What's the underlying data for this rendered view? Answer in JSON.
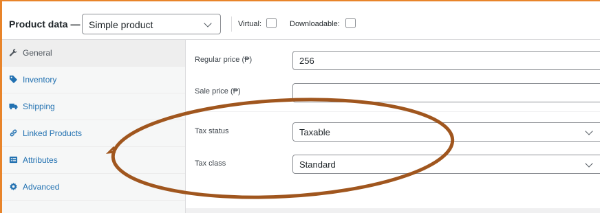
{
  "header": {
    "title": "Product data —",
    "product_type": "Simple product",
    "virtual_label": "Virtual:",
    "downloadable_label": "Downloadable:"
  },
  "sidebar": {
    "items": [
      {
        "label": "General",
        "icon": "wrench-icon",
        "active": true
      },
      {
        "label": "Inventory",
        "icon": "tag-icon",
        "active": false
      },
      {
        "label": "Shipping",
        "icon": "truck-icon",
        "active": false
      },
      {
        "label": "Linked Products",
        "icon": "link-icon",
        "active": false
      },
      {
        "label": "Attributes",
        "icon": "list-icon",
        "active": false
      },
      {
        "label": "Advanced",
        "icon": "gear-icon",
        "active": false
      }
    ]
  },
  "general": {
    "regular_price_label": "Regular price (₱)",
    "regular_price_value": "256",
    "sale_price_label": "Sale price (₱)",
    "sale_price_value": "",
    "tax_status_label": "Tax status",
    "tax_status_value": "Taxable",
    "tax_class_label": "Tax class",
    "tax_class_value": "Standard"
  },
  "colors": {
    "frame_accent": "#e8842a",
    "annotation": "#a0561e",
    "link": "#2271b1"
  }
}
